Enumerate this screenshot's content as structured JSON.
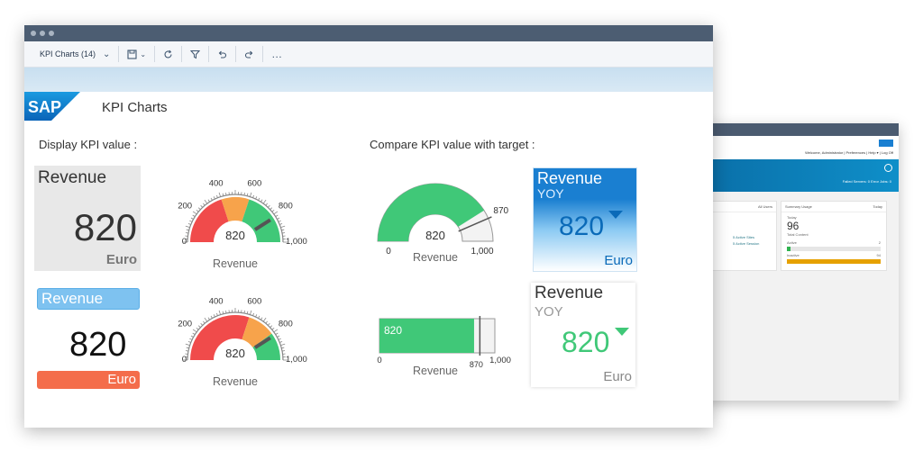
{
  "window": {
    "title": "KPI Charts"
  },
  "toolbar": {
    "menu_label": "KPI Charts (14)"
  },
  "icons": {
    "save": "save-icon",
    "refresh": "refresh-icon",
    "filter": "filter-icon",
    "undo": "undo-icon",
    "redo": "redo-icon",
    "more": "more-icon",
    "chevron": "chevron-down-icon",
    "logo": "sap-logo"
  },
  "colors": {
    "red": "#f04b4b",
    "orange": "#f7a34b",
    "green": "#40c878",
    "blue": "#0a6ab8",
    "tile_blue_light": "#7ec2f0",
    "tile_orange": "#f46d4b",
    "tile_gray": "#e8e8e8"
  },
  "logo_text": "SAP",
  "sections": {
    "display": "Display KPI value :",
    "compare": "Compare KPI value with target :"
  },
  "kpi": {
    "label": "Revenue",
    "value": "820",
    "unit": "Euro",
    "yoy": "YOY",
    "target": "870",
    "gauge_max": "1,000",
    "gauge_min": "0",
    "ticks": [
      "0",
      "200",
      "400",
      "600",
      "800",
      "1,000"
    ]
  },
  "chart_data": [
    {
      "type": "gauge",
      "title": "Revenue",
      "value": 820,
      "min": 0,
      "max": 1000,
      "bands": [
        {
          "from": 0,
          "to": 400,
          "color": "red"
        },
        {
          "from": 400,
          "to": 600,
          "color": "orange"
        },
        {
          "from": 600,
          "to": 1000,
          "color": "green"
        }
      ]
    },
    {
      "type": "gauge",
      "title": "Revenue",
      "value": 820,
      "min": 0,
      "max": 1000,
      "bands": [
        {
          "from": 0,
          "to": 600,
          "color": "red"
        },
        {
          "from": 600,
          "to": 800,
          "color": "orange"
        },
        {
          "from": 800,
          "to": 1000,
          "color": "green"
        }
      ]
    },
    {
      "type": "gauge",
      "title": "Revenue",
      "value": 820,
      "target": 870,
      "min": 0,
      "max": 1000
    },
    {
      "type": "bullet",
      "title": "Revenue",
      "value": 820,
      "target": 870,
      "min": 0,
      "max": 1000
    }
  ],
  "back_window": {
    "welcome": "Welcome, Administrator | Preferences | Help ▾ | Log Off",
    "banner_stats": "Failed Servers: 0    Error Jobs: 0",
    "card1": {
      "filter": "All Users",
      "items": [
        "5 Active Sites",
        "5 Active Session"
      ]
    },
    "card2": {
      "title": "Summary Usage",
      "filter": "Today",
      "period": "Today",
      "number": "96",
      "sub": "Total Content",
      "active_label": "Active",
      "active_val": "2",
      "inactive_label": "Inactive",
      "inactive_val": "94"
    }
  }
}
